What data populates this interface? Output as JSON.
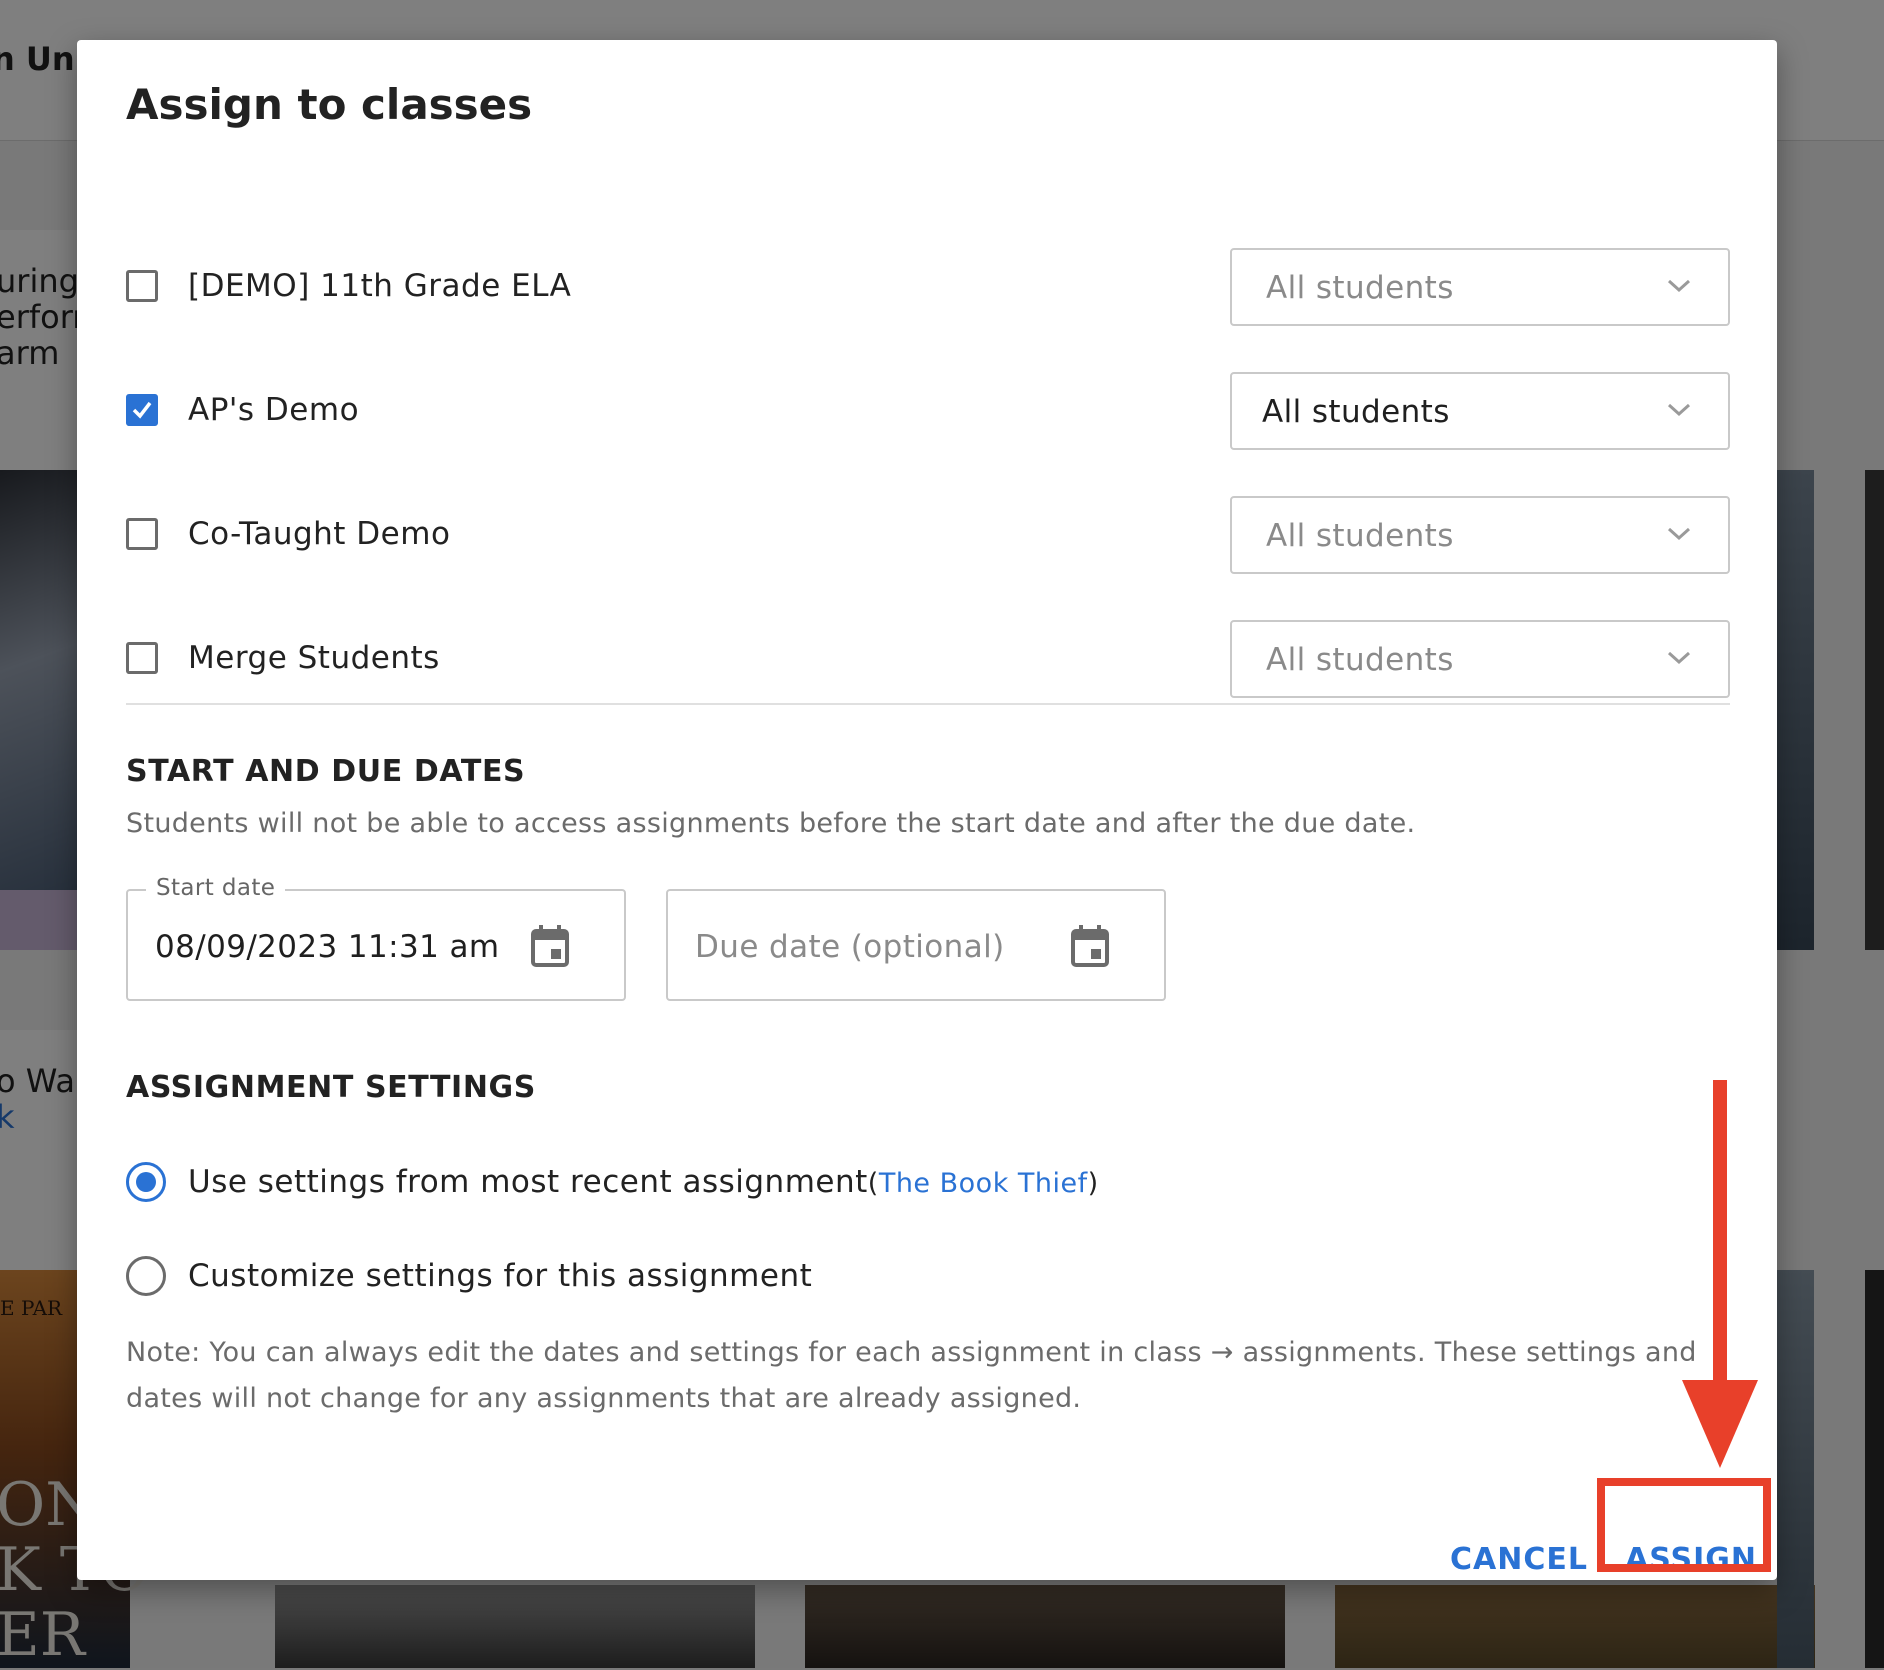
{
  "background": {
    "header_fragment": "n Unit",
    "card_text_1": [
      "uring",
      "erforn",
      "arm"
    ],
    "card_text_2": [
      "o Wa",
      "k"
    ],
    "book_cover_top": "E PAR",
    "book_cover_big": [
      "ONG",
      "K TO",
      "ER"
    ]
  },
  "modal": {
    "title": "Assign to classes",
    "classes": [
      {
        "label": "[DEMO] 11th Grade ELA",
        "checked": false,
        "students": "All students"
      },
      {
        "label": "AP's Demo",
        "checked": true,
        "students": "All students"
      },
      {
        "label": "Co-Taught Demo",
        "checked": false,
        "students": "All students"
      },
      {
        "label": "Merge Students",
        "checked": false,
        "students": "All students"
      }
    ],
    "dates": {
      "heading": "START AND DUE DATES",
      "description": "Students will not be able to access assignments before the start date and after the due date.",
      "start_label": "Start date",
      "start_value": "08/09/2023 11:31 am",
      "due_placeholder": "Due date (optional)"
    },
    "settings": {
      "heading": "ASSIGNMENT SETTINGS",
      "option_recent": "Use settings from most recent assignment",
      "paren_open": "(",
      "recent_link": "The Book Thief",
      "paren_close": ")",
      "option_custom": "Customize settings for this assignment",
      "selected": "recent"
    },
    "note": "Note: You can always edit the dates and settings for each assignment in class → assignments. These settings and dates will not change for any assignments that are already assigned.",
    "buttons": {
      "cancel": "CANCEL",
      "assign": "ASSIGN"
    }
  },
  "colors": {
    "accent": "#2a72d4",
    "annotation": "#e8402a"
  },
  "icons": [
    "checkbox-icon",
    "chevron-down-icon",
    "calendar-icon",
    "arrow-down-icon"
  ]
}
